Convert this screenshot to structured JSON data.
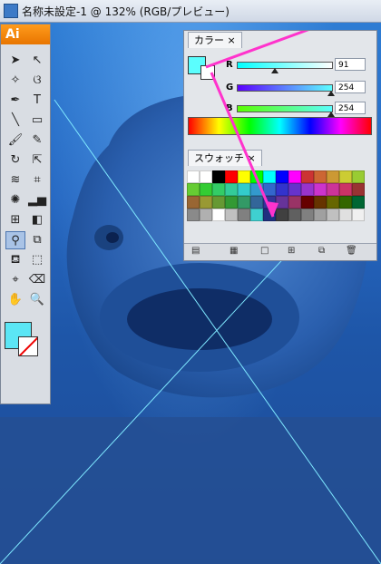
{
  "window": {
    "title": "名称未設定-1 @ 132% (RGB/プレビュー)"
  },
  "app_logo": "Ai",
  "tools": [
    {
      "name": "selection-tool",
      "glyph": "➤"
    },
    {
      "name": "direct-selection-tool",
      "glyph": "↖"
    },
    {
      "name": "magic-wand-tool",
      "glyph": "✧"
    },
    {
      "name": "lasso-tool",
      "glyph": "ଓ"
    },
    {
      "name": "pen-tool",
      "glyph": "✒"
    },
    {
      "name": "type-tool",
      "glyph": "T"
    },
    {
      "name": "line-tool",
      "glyph": "╲"
    },
    {
      "name": "rectangle-tool",
      "glyph": "▭"
    },
    {
      "name": "paintbrush-tool",
      "glyph": "🖌"
    },
    {
      "name": "pencil-tool",
      "glyph": "✎"
    },
    {
      "name": "rotate-tool",
      "glyph": "↻"
    },
    {
      "name": "scale-tool",
      "glyph": "⇱"
    },
    {
      "name": "warp-tool",
      "glyph": "≋"
    },
    {
      "name": "free-transform-tool",
      "glyph": "⌗"
    },
    {
      "name": "symbol-sprayer-tool",
      "glyph": "✺"
    },
    {
      "name": "column-graph-tool",
      "glyph": "▂▅"
    },
    {
      "name": "mesh-tool",
      "glyph": "⊞"
    },
    {
      "name": "gradient-tool",
      "glyph": "◧"
    },
    {
      "name": "eyedropper-tool",
      "glyph": "⚲"
    },
    {
      "name": "blend-tool",
      "glyph": "⧉"
    },
    {
      "name": "live-paint-bucket-tool",
      "glyph": "⛾"
    },
    {
      "name": "live-paint-selection-tool",
      "glyph": "⬚"
    },
    {
      "name": "crop-area-tool",
      "glyph": "⌖"
    },
    {
      "name": "eraser-tool",
      "glyph": "⌫"
    },
    {
      "name": "hand-tool",
      "glyph": "✋"
    },
    {
      "name": "zoom-tool",
      "glyph": "🔍"
    }
  ],
  "color_panel": {
    "tab_label": "カラー",
    "tab2_label": "スウォッチ",
    "r_label": "R",
    "r_value": "91",
    "g_label": "G",
    "g_value": "254",
    "b_label": "B",
    "b_value": "254",
    "fill_color": "#5bfefe"
  },
  "swatch_colors": [
    "#ffffff",
    "#ffffff",
    "#000000",
    "#ff0000",
    "#ffff00",
    "#00ff00",
    "#00ffff",
    "#0000ff",
    "#ff00ff",
    "#cc3333",
    "#cc6633",
    "#cc9933",
    "#cccc33",
    "#99cc33",
    "#66cc33",
    "#33cc33",
    "#33cc66",
    "#33cc99",
    "#33cccc",
    "#3399cc",
    "#3366cc",
    "#3333cc",
    "#6633cc",
    "#9933cc",
    "#cc33cc",
    "#cc3399",
    "#cc3366",
    "#993333",
    "#996633",
    "#999933",
    "#669933",
    "#339933",
    "#339966",
    "#336699",
    "#333399",
    "#663399",
    "#993366",
    "#660000",
    "#663300",
    "#666600",
    "#336600",
    "#006633",
    "#8a8a8a",
    "#b0b0b0",
    "#ffffff",
    "#c0c0c0",
    "#808080",
    "#3fd0d0",
    "#203080",
    "#404040",
    "#606060",
    "#808080",
    "#a0a0a0",
    "#c0c0c0",
    "#e0e0e0",
    "#f0f0f0"
  ]
}
